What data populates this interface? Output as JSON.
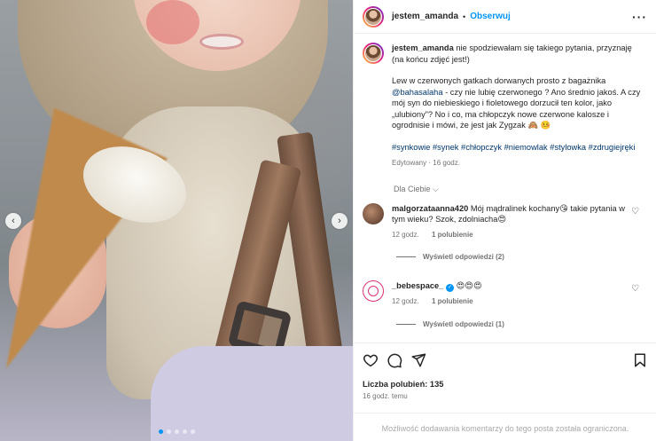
{
  "post": {
    "username": "jestem_amanda",
    "separator": "•",
    "follow_label": "Obserwuj",
    "more_label": "···",
    "caption_first": "nie spodziewałam się takiego pytania, przyznaję (na końcu zdjęć jest!)",
    "caption_p2_a": "Lew w czerwonych gatkach dorwanych prosto z bagażnika ",
    "caption_mention": "@bahasalaha",
    "caption_p2_b": " - czy nie lubię czerwonego ? Ano średnio jakoś. A czy mój syn do niebieskiego i fioletowego dorzucił ten kolor, jako „ulubiony”? No i co, ma chłopczyk nowe czerwone kalosze i ogrodnisie i mówi, że jest jak Zygzak 🙈 🤒",
    "hashtags": "#synkowie #synek #chłopczyk #niemowlak #stylowka #zdrugiejręki",
    "edited": "Edytowany · 16 godz.",
    "filter_label": "Dla Ciebie ⌵"
  },
  "media": {
    "prev_arrow": "‹",
    "next_arrow": "›",
    "slides": 5,
    "active_slide": 1
  },
  "comments": [
    {
      "user": "malgorzataanna420",
      "text": "Mój mądralinek kochany😘 takie pytania w tym wieku? Szok, zdolniacha😍",
      "time": "12 godz.",
      "likes": "1 polubienie",
      "replies": "Wyświetl odpowiedzi (2)"
    },
    {
      "user": "_bebespace_",
      "verified": "✓",
      "text": "😍😍😍",
      "time": "12 godz.",
      "likes": "1 polubienie",
      "replies": "Wyświetl odpowiedzi (1)"
    }
  ],
  "actions": {
    "likes_label": "Liczba polubień: 135",
    "time_ago": "16 godz. temu",
    "restricted_notice": "Możliwość dodawania komentarzy do tego posta została ograniczona."
  },
  "colors": {
    "accent": "#0095f6",
    "link": "#00376b",
    "muted": "#737373"
  }
}
